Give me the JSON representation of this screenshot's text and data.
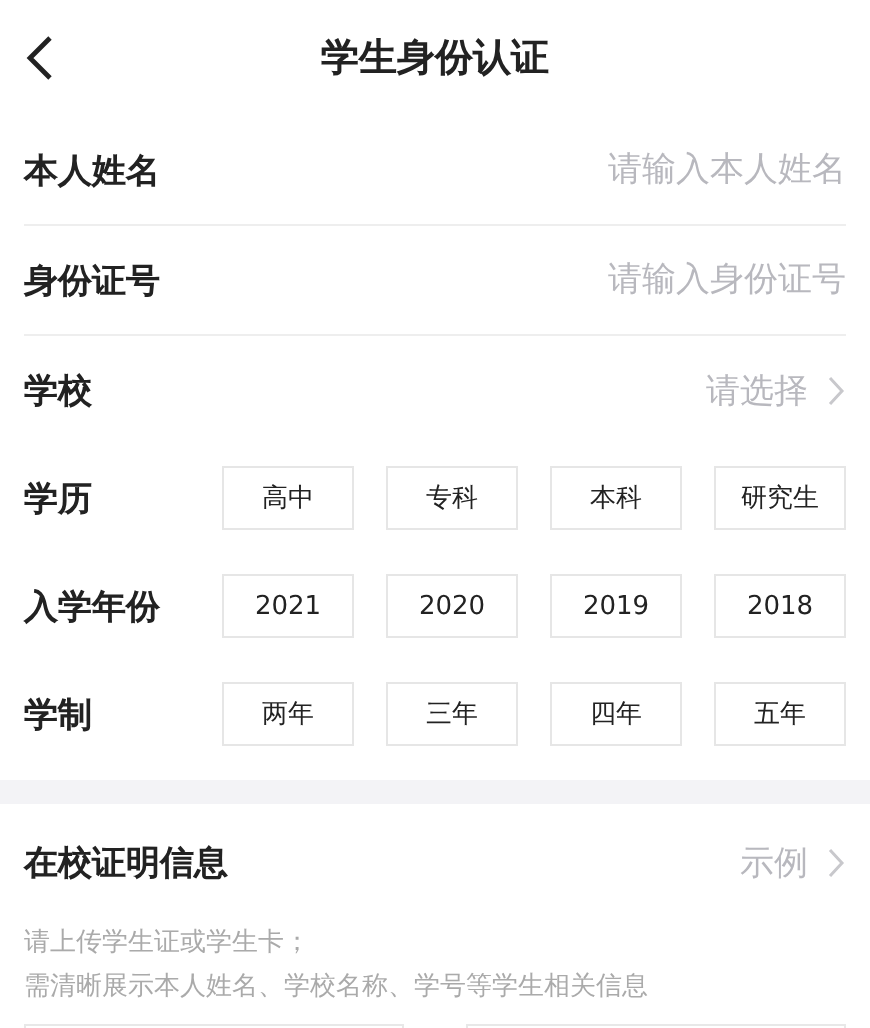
{
  "header": {
    "title": "学生身份认证"
  },
  "inputs": [
    {
      "label": "本人姓名",
      "placeholder": "请输入本人姓名"
    },
    {
      "label": "身份证号",
      "placeholder": "请输入身份证号"
    }
  ],
  "school": {
    "label": "学校",
    "value": "请选择"
  },
  "choices": [
    {
      "label": "学历",
      "options": [
        {
          "text": "高中",
          "selected": false
        },
        {
          "text": "专科",
          "selected": false
        },
        {
          "text": "本科",
          "selected": false
        },
        {
          "text": "研究生",
          "selected": false
        }
      ]
    },
    {
      "label": "入学年份",
      "options": [
        {
          "text": "2021",
          "selected": false
        },
        {
          "text": "2020",
          "selected": false
        },
        {
          "text": "2019",
          "selected": false
        },
        {
          "text": "2018",
          "selected": false
        }
      ]
    },
    {
      "label": "学制",
      "options": [
        {
          "text": "两年",
          "selected": false
        },
        {
          "text": "三年",
          "selected": false
        },
        {
          "text": "四年",
          "selected": false
        },
        {
          "text": "五年",
          "selected": false
        }
      ]
    }
  ],
  "proof": {
    "title": "在校证明信息",
    "example": "示例",
    "hints": [
      "请上传学生证或学生卡；",
      "需清晰展示本人姓名、学校名称、学号等学生相关信息"
    ]
  }
}
